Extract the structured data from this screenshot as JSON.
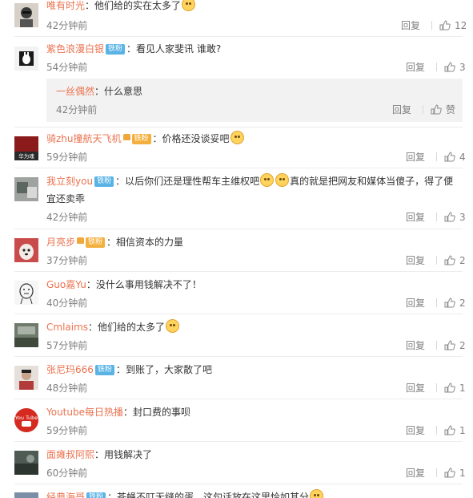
{
  "ui": {
    "reply_label": "回复",
    "like_label": "赞"
  },
  "comments": [
    {
      "user": "唯有时光",
      "badge": "",
      "text": "他们给的实在太多了",
      "time": "42分钟前",
      "likes": "12",
      "emoji_after": true
    },
    {
      "user": "紫色浪漫白银",
      "badge": "铁粉",
      "text": "看见人家斐讯 谁敢?",
      "time": "54分钟前",
      "likes": "3"
    },
    {
      "user": "骑zhu撞航天飞机",
      "badge": "铁粉",
      "text": "价格还没谈妥吧",
      "time": "59分钟前",
      "likes": "4",
      "avatar_text": "华为魂",
      "emoji_after": true
    },
    {
      "user": "我立刻you",
      "badge": "铁粉",
      "text": "以后你们还是理性帮车主维权吧",
      "text2": "真的就是把网友和媒体当傻子，得了便宜还卖乖",
      "time": "42分钟前",
      "likes": "3"
    },
    {
      "user": "月亮步",
      "badge": "铁粉",
      "text": "相信资本的力量",
      "time": "37分钟前",
      "likes": "2"
    },
    {
      "user": "Guo嘉Yu",
      "badge": "",
      "text": "没什么事用钱解决不了！",
      "time": "40分钟前",
      "likes": "2"
    },
    {
      "user": "Cmlaims",
      "badge": "",
      "text": "他们给的太多了",
      "time": "57分钟前",
      "likes": "2",
      "emoji_after": true
    },
    {
      "user": "张尼玛666",
      "badge": "铁粉",
      "text": "到账了，大家散了吧",
      "time": "48分钟前",
      "likes": "1"
    },
    {
      "user": "Youtube每日热播",
      "badge": "",
      "text": "封口费的事呗",
      "time": "59分钟前",
      "likes": "1",
      "avatar_text": "You Tube"
    },
    {
      "user": "面瘫叔阿熙",
      "badge": "",
      "text": "用钱解决了",
      "time": "60分钟前",
      "likes": "1"
    },
    {
      "user": "经典海哥",
      "badge": "铁粉",
      "text": "苍蝇不叮无缝的蛋，这句话放在这里恰如其分",
      "time": "",
      "likes": ""
    }
  ],
  "sub_reply": {
    "user": "一丝偶然",
    "text": "什么意思",
    "time": "42分钟前"
  },
  "colors": {
    "username": "#eb7350",
    "badge_blue": "#59b3e5",
    "badge_gold": "#f4b03e",
    "muted": "#808080",
    "subreply_bg": "#f2f2f2"
  }
}
